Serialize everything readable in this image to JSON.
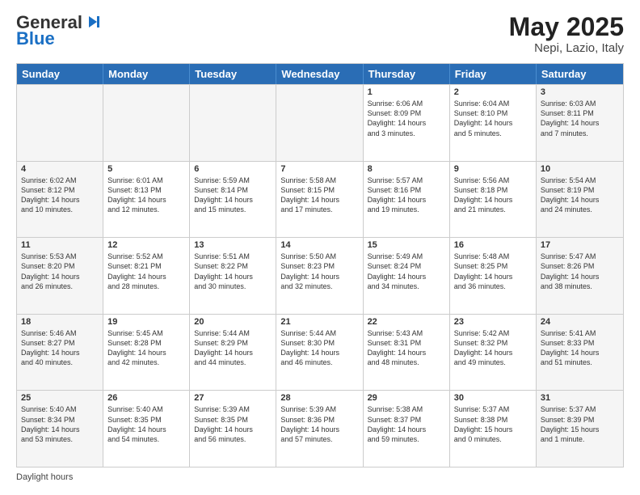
{
  "header": {
    "logo_general": "General",
    "logo_blue": "Blue",
    "main_title": "May 2025",
    "subtitle": "Nepi, Lazio, Italy"
  },
  "days_of_week": [
    "Sunday",
    "Monday",
    "Tuesday",
    "Wednesday",
    "Thursday",
    "Friday",
    "Saturday"
  ],
  "legend": "Daylight hours",
  "weeks": [
    [
      {
        "day": "",
        "empty": true
      },
      {
        "day": "",
        "empty": true
      },
      {
        "day": "",
        "empty": true
      },
      {
        "day": "",
        "empty": true
      },
      {
        "day": "1",
        "lines": [
          "Sunrise: 6:06 AM",
          "Sunset: 8:09 PM",
          "Daylight: 14 hours",
          "and 3 minutes."
        ]
      },
      {
        "day": "2",
        "lines": [
          "Sunrise: 6:04 AM",
          "Sunset: 8:10 PM",
          "Daylight: 14 hours",
          "and 5 minutes."
        ]
      },
      {
        "day": "3",
        "lines": [
          "Sunrise: 6:03 AM",
          "Sunset: 8:11 PM",
          "Daylight: 14 hours",
          "and 7 minutes."
        ]
      }
    ],
    [
      {
        "day": "4",
        "lines": [
          "Sunrise: 6:02 AM",
          "Sunset: 8:12 PM",
          "Daylight: 14 hours",
          "and 10 minutes."
        ]
      },
      {
        "day": "5",
        "lines": [
          "Sunrise: 6:01 AM",
          "Sunset: 8:13 PM",
          "Daylight: 14 hours",
          "and 12 minutes."
        ]
      },
      {
        "day": "6",
        "lines": [
          "Sunrise: 5:59 AM",
          "Sunset: 8:14 PM",
          "Daylight: 14 hours",
          "and 15 minutes."
        ]
      },
      {
        "day": "7",
        "lines": [
          "Sunrise: 5:58 AM",
          "Sunset: 8:15 PM",
          "Daylight: 14 hours",
          "and 17 minutes."
        ]
      },
      {
        "day": "8",
        "lines": [
          "Sunrise: 5:57 AM",
          "Sunset: 8:16 PM",
          "Daylight: 14 hours",
          "and 19 minutes."
        ]
      },
      {
        "day": "9",
        "lines": [
          "Sunrise: 5:56 AM",
          "Sunset: 8:18 PM",
          "Daylight: 14 hours",
          "and 21 minutes."
        ]
      },
      {
        "day": "10",
        "lines": [
          "Sunrise: 5:54 AM",
          "Sunset: 8:19 PM",
          "Daylight: 14 hours",
          "and 24 minutes."
        ]
      }
    ],
    [
      {
        "day": "11",
        "lines": [
          "Sunrise: 5:53 AM",
          "Sunset: 8:20 PM",
          "Daylight: 14 hours",
          "and 26 minutes."
        ]
      },
      {
        "day": "12",
        "lines": [
          "Sunrise: 5:52 AM",
          "Sunset: 8:21 PM",
          "Daylight: 14 hours",
          "and 28 minutes."
        ]
      },
      {
        "day": "13",
        "lines": [
          "Sunrise: 5:51 AM",
          "Sunset: 8:22 PM",
          "Daylight: 14 hours",
          "and 30 minutes."
        ]
      },
      {
        "day": "14",
        "lines": [
          "Sunrise: 5:50 AM",
          "Sunset: 8:23 PM",
          "Daylight: 14 hours",
          "and 32 minutes."
        ]
      },
      {
        "day": "15",
        "lines": [
          "Sunrise: 5:49 AM",
          "Sunset: 8:24 PM",
          "Daylight: 14 hours",
          "and 34 minutes."
        ]
      },
      {
        "day": "16",
        "lines": [
          "Sunrise: 5:48 AM",
          "Sunset: 8:25 PM",
          "Daylight: 14 hours",
          "and 36 minutes."
        ]
      },
      {
        "day": "17",
        "lines": [
          "Sunrise: 5:47 AM",
          "Sunset: 8:26 PM",
          "Daylight: 14 hours",
          "and 38 minutes."
        ]
      }
    ],
    [
      {
        "day": "18",
        "lines": [
          "Sunrise: 5:46 AM",
          "Sunset: 8:27 PM",
          "Daylight: 14 hours",
          "and 40 minutes."
        ]
      },
      {
        "day": "19",
        "lines": [
          "Sunrise: 5:45 AM",
          "Sunset: 8:28 PM",
          "Daylight: 14 hours",
          "and 42 minutes."
        ]
      },
      {
        "day": "20",
        "lines": [
          "Sunrise: 5:44 AM",
          "Sunset: 8:29 PM",
          "Daylight: 14 hours",
          "and 44 minutes."
        ]
      },
      {
        "day": "21",
        "lines": [
          "Sunrise: 5:44 AM",
          "Sunset: 8:30 PM",
          "Daylight: 14 hours",
          "and 46 minutes."
        ]
      },
      {
        "day": "22",
        "lines": [
          "Sunrise: 5:43 AM",
          "Sunset: 8:31 PM",
          "Daylight: 14 hours",
          "and 48 minutes."
        ]
      },
      {
        "day": "23",
        "lines": [
          "Sunrise: 5:42 AM",
          "Sunset: 8:32 PM",
          "Daylight: 14 hours",
          "and 49 minutes."
        ]
      },
      {
        "day": "24",
        "lines": [
          "Sunrise: 5:41 AM",
          "Sunset: 8:33 PM",
          "Daylight: 14 hours",
          "and 51 minutes."
        ]
      }
    ],
    [
      {
        "day": "25",
        "lines": [
          "Sunrise: 5:40 AM",
          "Sunset: 8:34 PM",
          "Daylight: 14 hours",
          "and 53 minutes."
        ]
      },
      {
        "day": "26",
        "lines": [
          "Sunrise: 5:40 AM",
          "Sunset: 8:35 PM",
          "Daylight: 14 hours",
          "and 54 minutes."
        ]
      },
      {
        "day": "27",
        "lines": [
          "Sunrise: 5:39 AM",
          "Sunset: 8:35 PM",
          "Daylight: 14 hours",
          "and 56 minutes."
        ]
      },
      {
        "day": "28",
        "lines": [
          "Sunrise: 5:39 AM",
          "Sunset: 8:36 PM",
          "Daylight: 14 hours",
          "and 57 minutes."
        ]
      },
      {
        "day": "29",
        "lines": [
          "Sunrise: 5:38 AM",
          "Sunset: 8:37 PM",
          "Daylight: 14 hours",
          "and 59 minutes."
        ]
      },
      {
        "day": "30",
        "lines": [
          "Sunrise: 5:37 AM",
          "Sunset: 8:38 PM",
          "Daylight: 15 hours",
          "and 0 minutes."
        ]
      },
      {
        "day": "31",
        "lines": [
          "Sunrise: 5:37 AM",
          "Sunset: 8:39 PM",
          "Daylight: 15 hours",
          "and 1 minute."
        ]
      }
    ]
  ]
}
